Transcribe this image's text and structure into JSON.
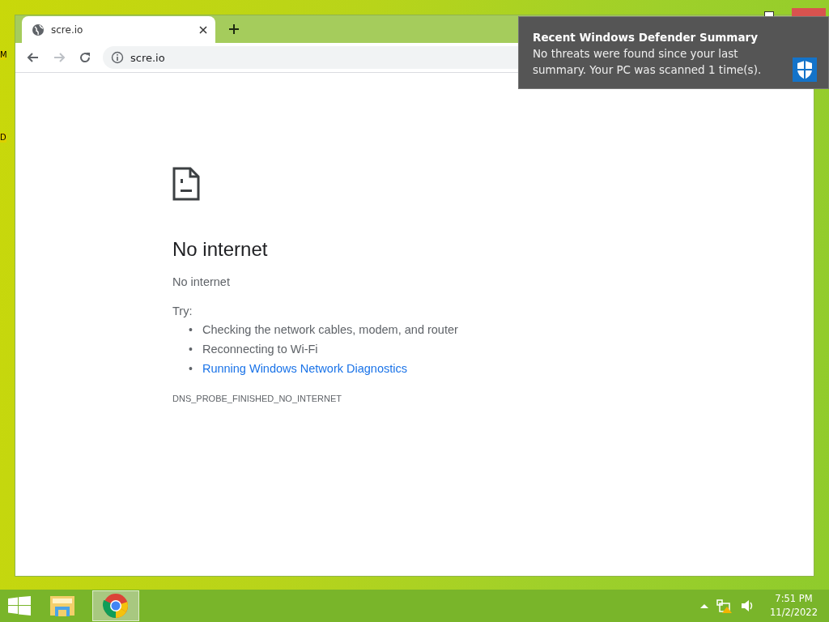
{
  "desktop": {
    "labels": [
      "M",
      "D"
    ]
  },
  "browser": {
    "tabs": [
      {
        "title": "scre.io",
        "selected": true
      }
    ],
    "toolbar": {
      "back_disabled": false,
      "forward_disabled": true,
      "url": "scre.io"
    },
    "page": {
      "heading": "No internet",
      "subheading": "No internet",
      "try_label": "Try:",
      "suggestions": [
        {
          "kind": "text",
          "bullet": "•",
          "text": "Checking the network cables, modem, and router"
        },
        {
          "kind": "text",
          "bullet": "•",
          "text": "Reconnecting to Wi-Fi"
        },
        {
          "kind": "link",
          "bullet": "•",
          "text": "Running Windows Network Diagnostics"
        }
      ],
      "error_code": "DNS_PROBE_FINISHED_NO_INTERNET"
    }
  },
  "notification": {
    "title": "Recent Windows Defender Summary",
    "body": "No threats were found since your last summary. Your PC was scanned 1 time(s)."
  },
  "taskbar": {
    "apps": [
      {
        "kind": "folder",
        "selected": false
      },
      {
        "kind": "chrome",
        "selected": true
      }
    ],
    "clock": {
      "time": "7:51 PM",
      "date": "11/2/2022"
    }
  }
}
